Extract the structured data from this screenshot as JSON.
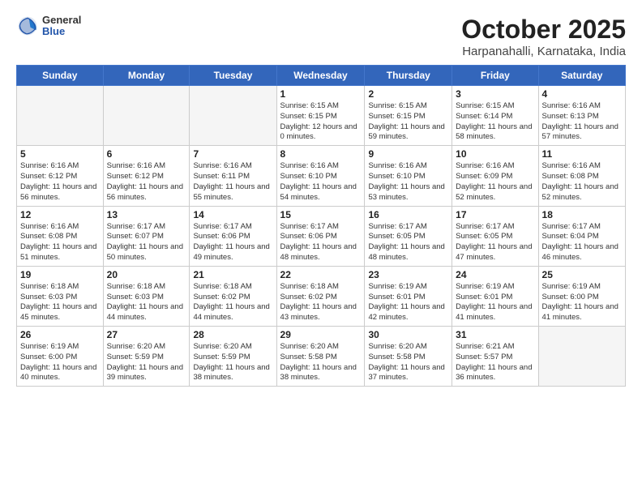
{
  "header": {
    "logo_general": "General",
    "logo_blue": "Blue",
    "title": "October 2025",
    "subtitle": "Harpanahalli, Karnataka, India"
  },
  "weekdays": [
    "Sunday",
    "Monday",
    "Tuesday",
    "Wednesday",
    "Thursday",
    "Friday",
    "Saturday"
  ],
  "weeks": [
    [
      {
        "day": "",
        "info": ""
      },
      {
        "day": "",
        "info": ""
      },
      {
        "day": "",
        "info": ""
      },
      {
        "day": "1",
        "info": "Sunrise: 6:15 AM\nSunset: 6:15 PM\nDaylight: 12 hours\nand 0 minutes."
      },
      {
        "day": "2",
        "info": "Sunrise: 6:15 AM\nSunset: 6:15 PM\nDaylight: 11 hours\nand 59 minutes."
      },
      {
        "day": "3",
        "info": "Sunrise: 6:15 AM\nSunset: 6:14 PM\nDaylight: 11 hours\nand 58 minutes."
      },
      {
        "day": "4",
        "info": "Sunrise: 6:16 AM\nSunset: 6:13 PM\nDaylight: 11 hours\nand 57 minutes."
      }
    ],
    [
      {
        "day": "5",
        "info": "Sunrise: 6:16 AM\nSunset: 6:12 PM\nDaylight: 11 hours\nand 56 minutes."
      },
      {
        "day": "6",
        "info": "Sunrise: 6:16 AM\nSunset: 6:12 PM\nDaylight: 11 hours\nand 56 minutes."
      },
      {
        "day": "7",
        "info": "Sunrise: 6:16 AM\nSunset: 6:11 PM\nDaylight: 11 hours\nand 55 minutes."
      },
      {
        "day": "8",
        "info": "Sunrise: 6:16 AM\nSunset: 6:10 PM\nDaylight: 11 hours\nand 54 minutes."
      },
      {
        "day": "9",
        "info": "Sunrise: 6:16 AM\nSunset: 6:10 PM\nDaylight: 11 hours\nand 53 minutes."
      },
      {
        "day": "10",
        "info": "Sunrise: 6:16 AM\nSunset: 6:09 PM\nDaylight: 11 hours\nand 52 minutes."
      },
      {
        "day": "11",
        "info": "Sunrise: 6:16 AM\nSunset: 6:08 PM\nDaylight: 11 hours\nand 52 minutes."
      }
    ],
    [
      {
        "day": "12",
        "info": "Sunrise: 6:16 AM\nSunset: 6:08 PM\nDaylight: 11 hours\nand 51 minutes."
      },
      {
        "day": "13",
        "info": "Sunrise: 6:17 AM\nSunset: 6:07 PM\nDaylight: 11 hours\nand 50 minutes."
      },
      {
        "day": "14",
        "info": "Sunrise: 6:17 AM\nSunset: 6:06 PM\nDaylight: 11 hours\nand 49 minutes."
      },
      {
        "day": "15",
        "info": "Sunrise: 6:17 AM\nSunset: 6:06 PM\nDaylight: 11 hours\nand 48 minutes."
      },
      {
        "day": "16",
        "info": "Sunrise: 6:17 AM\nSunset: 6:05 PM\nDaylight: 11 hours\nand 48 minutes."
      },
      {
        "day": "17",
        "info": "Sunrise: 6:17 AM\nSunset: 6:05 PM\nDaylight: 11 hours\nand 47 minutes."
      },
      {
        "day": "18",
        "info": "Sunrise: 6:17 AM\nSunset: 6:04 PM\nDaylight: 11 hours\nand 46 minutes."
      }
    ],
    [
      {
        "day": "19",
        "info": "Sunrise: 6:18 AM\nSunset: 6:03 PM\nDaylight: 11 hours\nand 45 minutes."
      },
      {
        "day": "20",
        "info": "Sunrise: 6:18 AM\nSunset: 6:03 PM\nDaylight: 11 hours\nand 44 minutes."
      },
      {
        "day": "21",
        "info": "Sunrise: 6:18 AM\nSunset: 6:02 PM\nDaylight: 11 hours\nand 44 minutes."
      },
      {
        "day": "22",
        "info": "Sunrise: 6:18 AM\nSunset: 6:02 PM\nDaylight: 11 hours\nand 43 minutes."
      },
      {
        "day": "23",
        "info": "Sunrise: 6:19 AM\nSunset: 6:01 PM\nDaylight: 11 hours\nand 42 minutes."
      },
      {
        "day": "24",
        "info": "Sunrise: 6:19 AM\nSunset: 6:01 PM\nDaylight: 11 hours\nand 41 minutes."
      },
      {
        "day": "25",
        "info": "Sunrise: 6:19 AM\nSunset: 6:00 PM\nDaylight: 11 hours\nand 41 minutes."
      }
    ],
    [
      {
        "day": "26",
        "info": "Sunrise: 6:19 AM\nSunset: 6:00 PM\nDaylight: 11 hours\nand 40 minutes."
      },
      {
        "day": "27",
        "info": "Sunrise: 6:20 AM\nSunset: 5:59 PM\nDaylight: 11 hours\nand 39 minutes."
      },
      {
        "day": "28",
        "info": "Sunrise: 6:20 AM\nSunset: 5:59 PM\nDaylight: 11 hours\nand 38 minutes."
      },
      {
        "day": "29",
        "info": "Sunrise: 6:20 AM\nSunset: 5:58 PM\nDaylight: 11 hours\nand 38 minutes."
      },
      {
        "day": "30",
        "info": "Sunrise: 6:20 AM\nSunset: 5:58 PM\nDaylight: 11 hours\nand 37 minutes."
      },
      {
        "day": "31",
        "info": "Sunrise: 6:21 AM\nSunset: 5:57 PM\nDaylight: 11 hours\nand 36 minutes."
      },
      {
        "day": "",
        "info": ""
      }
    ]
  ]
}
